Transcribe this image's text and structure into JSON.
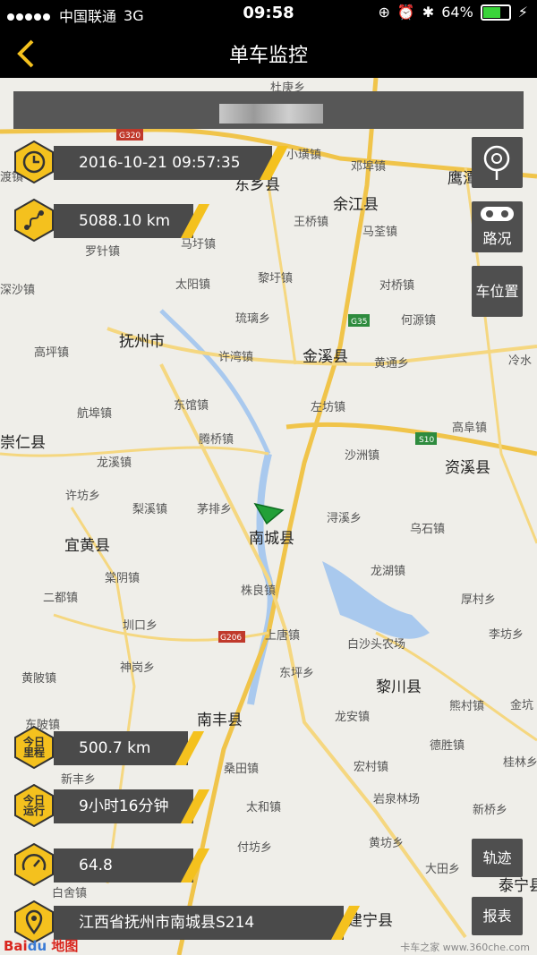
{
  "status_bar": {
    "carrier": "中国联通",
    "network": "3G",
    "time": "09:58",
    "battery": "64%",
    "battery_level": 0.64
  },
  "nav": {
    "title": "单车监控"
  },
  "vehicle": {
    "datetime": "2016-10-21 09:57:35",
    "total_mileage": "5088.10 km",
    "today_mileage": "500.7 km",
    "today_runtime": "9小时16分钟",
    "speed": "64.8",
    "location": "江西省抚州市南城县S214"
  },
  "hex_labels": {
    "today_mileage": "今日\n里程",
    "today_runtime": "今日\n运行"
  },
  "buttons": {
    "traffic": "路况",
    "car_position": "车位置",
    "track": "轨迹",
    "report": "报表"
  },
  "map": {
    "road_labels": [
      "G320",
      "G35",
      "S10",
      "G206"
    ],
    "places": {
      "big": [
        "东乡县",
        "余江县",
        "鹰潭市",
        "抚州市",
        "金溪县",
        "崇仁县",
        "资溪县",
        "宜黄县",
        "南城县",
        "黎川县",
        "南丰县",
        "建宁县",
        "泰宁县"
      ],
      "small": [
        "杜庚乡",
        "小璜镇",
        "邓埠镇",
        "王桥镇",
        "马荃镇",
        "马圩镇",
        "罗针镇",
        "太阳镇",
        "黎圩镇",
        "对桥镇",
        "何源镇",
        "琉璃乡",
        "许湾镇",
        "黄通乡",
        "高坪镇",
        "冷水",
        "东馆镇",
        "左坊镇",
        "航埠镇",
        "高阜镇",
        "腾桥镇",
        "沙洲镇",
        "龙溪镇",
        "许坊乡",
        "梨溪镇",
        "茅排乡",
        "浔溪乡",
        "乌石镇",
        "龙湖镇",
        "棠阴镇",
        "株良镇",
        "厚村乡",
        "二都镇",
        "圳口乡",
        "上唐镇",
        "白沙头农场",
        "李坊乡",
        "神岗乡",
        "东坪乡",
        "黄陂镇",
        "龙安镇",
        "熊村镇",
        "金坑",
        "东陂镇",
        "德胜镇",
        "宏村镇",
        "桂林乡",
        "新丰乡",
        "桑田镇",
        "岩泉林场",
        "新桥乡",
        "太和镇",
        "付坊乡",
        "黄坊乡",
        "大田乡",
        "白舍镇",
        "深沙镇",
        "渡镇"
      ]
    }
  },
  "logo": "Baidu地图",
  "watermark": "卡车之家 www.360che.com"
}
